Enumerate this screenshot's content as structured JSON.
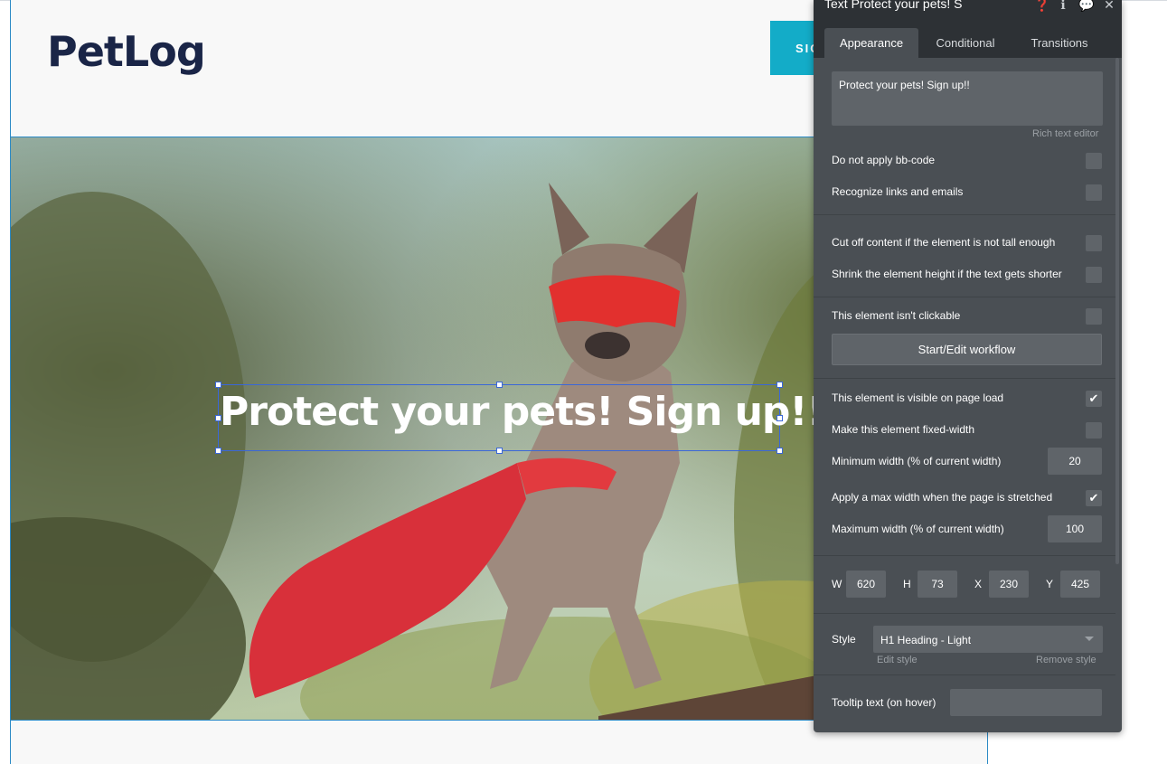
{
  "app": {
    "logo": "PetLog",
    "signup_button": "SIGN UP"
  },
  "hero": {
    "heading": "Protect your pets! Sign up!!"
  },
  "panel": {
    "title": "Text Protect your pets! S",
    "tabs": [
      "Appearance",
      "Conditional",
      "Transitions"
    ],
    "active_tab": "Appearance",
    "content_text": "Protect your pets! Sign up!!",
    "rich_text_editor_link": "Rich text editor",
    "options": {
      "do_not_apply_bbcode": {
        "label": "Do not apply bb-code",
        "checked": false
      },
      "recognize_links": {
        "label": "Recognize links and emails",
        "checked": false
      },
      "cut_off_content": {
        "label": "Cut off content if the element is not tall enough",
        "checked": false
      },
      "shrink_height": {
        "label": "Shrink the element height if the text gets shorter",
        "checked": false
      },
      "not_clickable": {
        "label": "This element isn't clickable",
        "checked": false
      },
      "visible_on_load": {
        "label": "This element is visible on page load",
        "checked": true
      },
      "fixed_width": {
        "label": "Make this element fixed-width",
        "checked": false
      },
      "apply_max_width": {
        "label": "Apply a max width when the page is stretched",
        "checked": true
      }
    },
    "workflow_button": "Start/Edit workflow",
    "min_width": {
      "label": "Minimum width (% of current width)",
      "value": "20"
    },
    "max_width": {
      "label": "Maximum width (% of current width)",
      "value": "100"
    },
    "dimensions": {
      "w_label": "W",
      "w": "620",
      "h_label": "H",
      "h": "73",
      "x_label": "X",
      "x": "230",
      "y_label": "Y",
      "y": "425"
    },
    "style": {
      "label": "Style",
      "value": "H1 Heading - Light",
      "edit_link": "Edit style",
      "remove_link": "Remove style"
    },
    "tooltip": {
      "label": "Tooltip text (on hover)",
      "value": ""
    },
    "icons": [
      "help-icon",
      "info-icon",
      "comment-icon",
      "close-icon"
    ]
  }
}
